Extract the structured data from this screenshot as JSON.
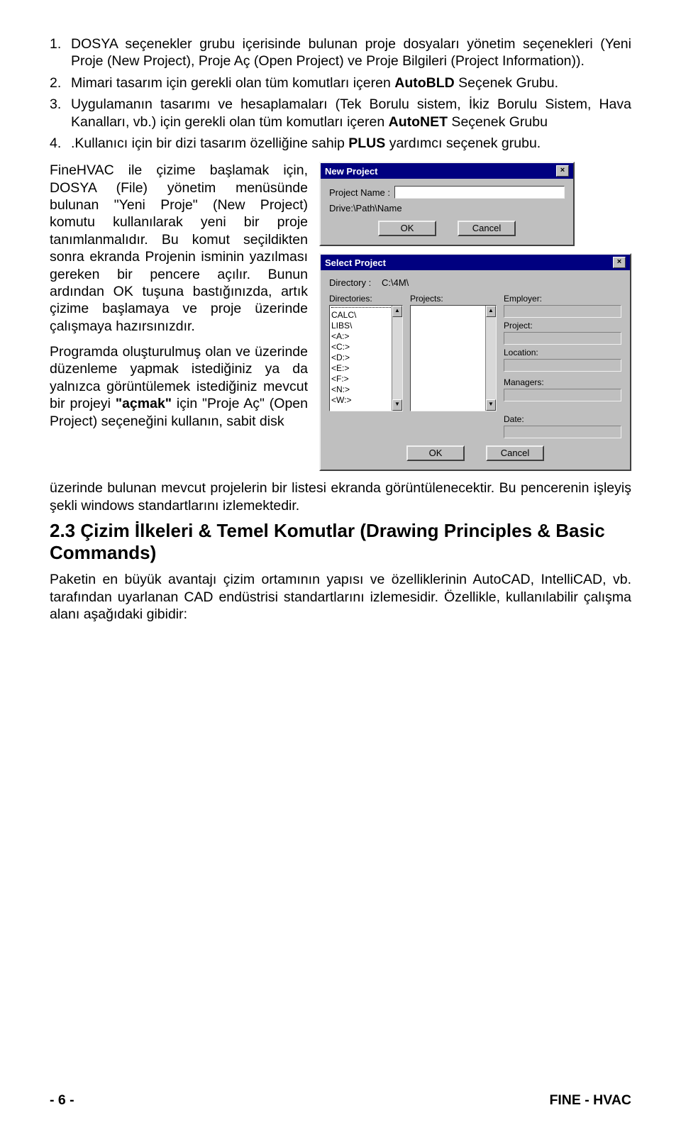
{
  "list": {
    "i1": {
      "num": "1.",
      "pre": "DOSYA seçenekler grubu içerisinde bulunan proje dosyaları yönetim seçenekleri (Yeni Proje (New Project), Proje Aç (Open Project) ve Proje Bilgileri (Project Information))."
    },
    "i2": {
      "num": "2.",
      "pre": "Mimari tasarım için gerekli olan tüm komutları içeren ",
      "bold": "AutoBLD",
      "post": " Seçenek Grubu."
    },
    "i3": {
      "num": "3.",
      "pre": "Uygulamanın tasarımı ve hesaplamaları (Tek Borulu sistem, İkiz Borulu Sistem, Hava Kanalları, vb.) için gerekli olan tüm komutları içeren ",
      "bold": "AutoNET",
      "post": " Seçenek Grubu"
    },
    "i4": {
      "num": "4.",
      "pre": ".Kullanıcı için bir dizi tasarım özelliğine sahip ",
      "bold": "PLUS",
      "post": " yardımcı seçenek grubu."
    }
  },
  "para1": "FineHVAC ile çizime başlamak için, DOSYA (File) yönetim menüsünde bulunan \"Yeni Proje\" (New Project) komutu kullanılarak yeni bir proje tanımlanmalıdır. Bu komut seçildikten sonra ekranda Projenin isminin yazılması gereken bir pencere açılır. Bunun ardından OK tuşuna bastığınızda, artık çizime başlamaya ve proje üzerinde çalışmaya hazırsınızdır.",
  "para2_a": "Programda oluşturulmuş olan ve üzerinde düzenleme yapmak istediğiniz ya da yalnızca görüntülemek istediğiniz mevcut bir projeyi ",
  "para2_b": "\"açmak\"",
  "para2_c": " için \"Proje Aç\" (Open Project) seçeneğini kullanın, sabit disk",
  "para3": "üzerinde bulunan mevcut projelerin bir listesi ekranda görüntülenecektir. Bu pencerenin işleyiş şekli windows standartlarını izlemektedir.",
  "heading": "2.3 Çizim İlkeleri & Temel Komutlar (Drawing Principles & Basic Commands)",
  "para4": "Paketin en büyük avantajı çizim ortamının yapısı ve özelliklerinin AutoCAD, IntelliCAD, vb. tarafından uyarlanan CAD endüstrisi standartlarını izlemesidir. Özellikle, kullanılabilir çalışma alanı aşağıdaki gibidir:",
  "dlg1": {
    "title": "New Project",
    "projectName": "Project Name    :",
    "drivePath": "Drive:\\Path\\Name",
    "ok": "OK",
    "cancel": "Cancel"
  },
  "dlg2": {
    "title": "Select Project",
    "directoryLabel": "Directory :",
    "directoryValue": "C:\\4M\\",
    "dirHeader": "Directories:",
    "dirs": [
      "CALC\\",
      "LIBS\\",
      "<A:>",
      "<C:>",
      "<D:>",
      "<E:>",
      "<F:>",
      "<N:>",
      "<W:>"
    ],
    "projHeader": "Projects:",
    "employer": "Employer:",
    "project": "Project:",
    "location": "Location:",
    "managers": "Managers:",
    "date": "Date:",
    "ok": "OK",
    "cancel": "Cancel"
  },
  "footer": {
    "left": "- 6 -",
    "right": "FINE - HVAC"
  }
}
